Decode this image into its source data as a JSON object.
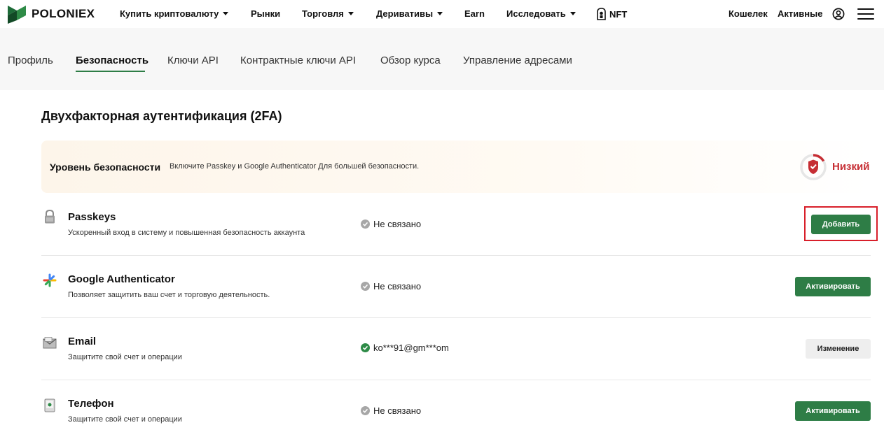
{
  "nav": {
    "brand": "POLONIEX",
    "items": [
      {
        "label": "Купить криптовалюту",
        "dropdown": true
      },
      {
        "label": "Рынки",
        "dropdown": false
      },
      {
        "label": "Торговля",
        "dropdown": true
      },
      {
        "label": "Деривативы",
        "dropdown": true
      },
      {
        "label": "Earn",
        "dropdown": false
      },
      {
        "label": "Исследовать",
        "dropdown": true
      },
      {
        "label": "NFT",
        "dropdown": false
      }
    ],
    "wallet": "Кошелек",
    "assets": "Активные",
    "icons": {
      "user": "user-circle-icon",
      "menu": "hamburger-menu-icon",
      "nft": "nft-icon"
    }
  },
  "tabs": [
    {
      "label": "Профиль",
      "active": false
    },
    {
      "label": "Безопасность",
      "active": true
    },
    {
      "label": "Ключи API",
      "active": false
    },
    {
      "label": "Контрактные ключи API",
      "active": false
    },
    {
      "label": "Обзор курса",
      "active": false
    },
    {
      "label": "Управление адресами",
      "active": false
    }
  ],
  "section_title": "Двухфакторная аутентификация (2FA)",
  "security_level": {
    "label": "Уровень безопасности",
    "hint": "Включите Passkey и Google Authenticator Для большей безопасности.",
    "status": "Низкий",
    "status_color": "#c62d33"
  },
  "methods": [
    {
      "title": "Passkeys",
      "desc": "Ускоренный вход в систему и повышенная безопасность аккаунта",
      "status": "Не связано",
      "linked": false,
      "button": "Добавить",
      "icon": "lock-icon"
    },
    {
      "title": "Google Authenticator",
      "desc": "Позволяет защитить ваш счет и торговую деятельность.",
      "status": "Не связано",
      "linked": false,
      "button": "Активировать",
      "icon": "google-authenticator-icon"
    },
    {
      "title": "Email",
      "desc": "Защитите свой счет и операции",
      "status": "ko***91@gm***om",
      "linked": true,
      "button": "Изменение",
      "icon": "envelope-icon"
    },
    {
      "title": "Телефон",
      "desc": "Защитите свой счет и операции",
      "status": "Не связано",
      "linked": false,
      "button": "Активировать",
      "icon": "phone-icon"
    }
  ],
  "colors": {
    "accent": "#2e7d46",
    "danger": "#c62d33",
    "highlight": "#d81f2a"
  }
}
